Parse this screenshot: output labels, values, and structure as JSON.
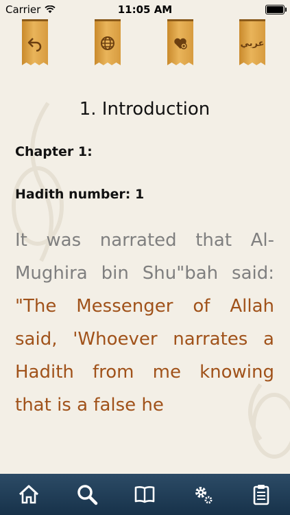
{
  "status_bar": {
    "carrier": "Carrier",
    "time": "11:05 AM",
    "battery_level": 1.0
  },
  "toolbar": {
    "items": [
      {
        "icon": "back-arrow-icon"
      },
      {
        "icon": "globe-icon"
      },
      {
        "icon": "heart-add-icon"
      },
      {
        "icon": "arabic-text-icon",
        "label": "عربي"
      }
    ]
  },
  "content": {
    "title": "1. Introduction",
    "chapter": "Chapter 1:",
    "hadith_number": "Hadith number: 1",
    "narration": "It was narrated that Al-Mughira bin Shu\"bah said: ",
    "quote": "\"The Messenger of Allah said, 'Whoever narrates a Hadith from me knowing that is a false he"
  },
  "tabbar": {
    "items": [
      {
        "icon": "home-icon"
      },
      {
        "icon": "search-icon"
      },
      {
        "icon": "book-icon"
      },
      {
        "icon": "settings-icon"
      },
      {
        "icon": "clipboard-icon"
      }
    ]
  },
  "colors": {
    "background": "#f3efe6",
    "banner": "#e0a84e",
    "narration_text": "#7f7f7f",
    "quote_text": "#a0521a",
    "tabbar": "#1f3c56"
  }
}
